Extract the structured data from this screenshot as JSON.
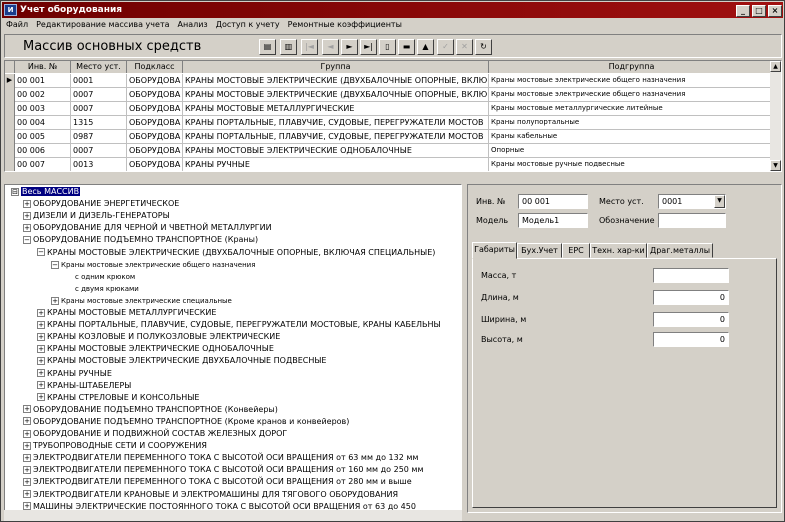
{
  "window": {
    "title": "Учет оборудования",
    "icon_label": "И",
    "controls": [
      "_",
      "□",
      "×"
    ]
  },
  "menu": [
    "Файл",
    "Редактирование массива учета",
    "Анализ",
    "Доступ к учету",
    "Ремонтные коэффициенты"
  ],
  "header": {
    "title": "Массив основных средств"
  },
  "nav_buttons": [
    {
      "icon": "export-icon",
      "glyph": "▤",
      "enabled": true
    },
    {
      "icon": "import-icon",
      "glyph": "▥",
      "enabled": true
    },
    {
      "icon": "first-icon",
      "glyph": "|◄",
      "enabled": false
    },
    {
      "icon": "prev-icon",
      "glyph": "◄",
      "enabled": false
    },
    {
      "icon": "next-icon",
      "glyph": "►",
      "enabled": true
    },
    {
      "icon": "last-icon",
      "glyph": "►|",
      "enabled": true
    },
    {
      "icon": "new-icon",
      "glyph": "▯",
      "enabled": true
    },
    {
      "icon": "delete-icon",
      "glyph": "▬",
      "enabled": true
    },
    {
      "icon": "edit-icon",
      "glyph": "▲",
      "enabled": true
    },
    {
      "icon": "post-icon",
      "glyph": "✓",
      "enabled": false
    },
    {
      "icon": "cancel-icon",
      "glyph": "✕",
      "enabled": false
    },
    {
      "icon": "refresh-icon",
      "glyph": "↻",
      "enabled": true
    }
  ],
  "grid": {
    "columns": [
      "Инв. №",
      "Место уст.",
      "Подкласс",
      "Группа",
      "Подгруппа"
    ],
    "rows": [
      [
        "00 001",
        "0001",
        "ОБОРУДОВА",
        "КРАНЫ МОСТОВЫЕ ЭЛЕКТРИЧЕСКИЕ (ДВУХБАЛОЧНЫЕ ОПОРНЫЕ, ВКЛЮ",
        "Краны мостовые электрические общего назначения"
      ],
      [
        "00 002",
        "0007",
        "ОБОРУДОВА",
        "КРАНЫ МОСТОВЫЕ ЭЛЕКТРИЧЕСКИЕ (ДВУХБАЛОЧНЫЕ ОПОРНЫЕ, ВКЛЮ",
        "Краны мостовые электрические общего назначения"
      ],
      [
        "00 003",
        "0007",
        "ОБОРУДОВА",
        "КРАНЫ МОСТОВЫЕ МЕТАЛЛУРГИЧЕСКИЕ",
        "Краны мостовые металлургические литейные"
      ],
      [
        "00 004",
        "1315",
        "ОБОРУДОВА",
        "КРАНЫ ПОРТАЛЬНЫЕ, ПЛАВУЧИЕ, СУДОВЫЕ, ПЕРЕГРУЖАТЕЛИ МОСТОВ",
        "Краны полупортальные"
      ],
      [
        "00 005",
        "0987",
        "ОБОРУДОВА",
        "КРАНЫ ПОРТАЛЬНЫЕ, ПЛАВУЧИЕ, СУДОВЫЕ, ПЕРЕГРУЖАТЕЛИ МОСТОВ",
        "Краны кабельные"
      ],
      [
        "00 006",
        "0007",
        "ОБОРУДОВА",
        "КРАНЫ МОСТОВЫЕ ЭЛЕКТРИЧЕСКИЕ ОДНОБАЛОЧНЫЕ",
        "Опорные"
      ],
      [
        "00 007",
        "0013",
        "ОБОРУДОВА",
        "КРАНЫ РУЧНЫЕ",
        "Краны мостовые ручные подвесные"
      ]
    ]
  },
  "tree": [
    {
      "level": 0,
      "box": "⊟",
      "text": "Весь МАССИВ",
      "selected": true
    },
    {
      "level": 1,
      "box": "+",
      "text": "ОБОРУДОВАНИЕ ЭНЕРГЕТИЧЕСКОЕ"
    },
    {
      "level": 1,
      "box": "+",
      "text": "ДИЗЕЛИ И ДИЗЕЛЬ-ГЕНЕРАТОРЫ"
    },
    {
      "level": 1,
      "box": "+",
      "text": "ОБОРУДОВАНИЕ ДЛЯ ЧЕРНОЙ И ЧВЕТНОЙ МЕТАЛЛУРГИИ"
    },
    {
      "level": 1,
      "box": "−",
      "text": "ОБОРУДОВАНИЕ ПОДЪЕМНО ТРАНСПОРТНОЕ (Краны)"
    },
    {
      "level": 2,
      "box": "−",
      "text": "КРАНЫ МОСТОВЫЕ ЭЛЕКТРИЧЕСКИЕ (ДВУХБАЛОЧНЫЕ ОПОРНЫЕ, ВКЛЮЧАЯ СПЕЦИАЛЬНЫЕ)"
    },
    {
      "level": 3,
      "box": "−",
      "text": "Краны мостовые электрические общего назначения",
      "small": true
    },
    {
      "level": 4,
      "box": "",
      "text": "с одним крюком",
      "small": true
    },
    {
      "level": 4,
      "box": "",
      "text": "с двумя крюками",
      "small": true
    },
    {
      "level": 3,
      "box": "+",
      "text": "Краны мостовые электрические специальные",
      "small": true
    },
    {
      "level": 2,
      "box": "+",
      "text": "КРАНЫ МОСТОВЫЕ МЕТАЛЛУРГИЧЕСКИЕ"
    },
    {
      "level": 2,
      "box": "+",
      "text": "КРАНЫ ПОРТАЛЬНЫЕ, ПЛАВУЧИЕ, СУДОВЫЕ, ПЕРЕГРУЖАТЕЛИ МОСТОВЫЕ, КРАНЫ КАБЕЛЬНЫ"
    },
    {
      "level": 2,
      "box": "+",
      "text": "КРАНЫ КОЗЛОВЫЕ И ПОЛУКОЗЛОВЫЕ ЭЛЕКТРИЧЕСКИЕ"
    },
    {
      "level": 2,
      "box": "+",
      "text": "КРАНЫ МОСТОВЫЕ ЭЛЕКТРИЧЕСКИЕ ОДНОБАЛОЧНЫЕ"
    },
    {
      "level": 2,
      "box": "+",
      "text": "КРАНЫ МОСТОВЫЕ ЭЛЕКТРИЧЕСКИЕ ДВУХБАЛОЧНЫЕ ПОДВЕСНЫЕ"
    },
    {
      "level": 2,
      "box": "+",
      "text": "КРАНЫ РУЧНЫЕ"
    },
    {
      "level": 2,
      "box": "+",
      "text": "КРАНЫ-ШТАБЕЛЕРЫ"
    },
    {
      "level": 2,
      "box": "+",
      "text": "КРАНЫ СТРЕЛОВЫЕ И КОНСОЛЬНЫЕ"
    },
    {
      "level": 1,
      "box": "+",
      "text": "ОБОРУДОВАНИЕ ПОДЪЕМНО ТРАНСПОРТНОЕ (Конвейеры)"
    },
    {
      "level": 1,
      "box": "+",
      "text": "ОБОРУДОВАНИЕ ПОДЪЕМНО ТРАНСПОРТНОЕ (Кроме кранов и конвейеров)"
    },
    {
      "level": 1,
      "box": "+",
      "text": "ОБОРУДОВАНИЕ И ПОДВИЖНОЙ СОСТАВ ЖЕЛЕЗНЫХ ДОРОГ"
    },
    {
      "level": 1,
      "box": "+",
      "text": "ТРУБОПРОВОДНЫЕ СЕТИ И СООРУЖЕНИЯ"
    },
    {
      "level": 1,
      "box": "+",
      "text": "ЭЛЕКТРОДВИГАТЕЛИ ПЕРЕМЕННОГО ТОКА С ВЫСОТОЙ ОСИ ВРАЩЕНИЯ от 63 мм до 132 мм"
    },
    {
      "level": 1,
      "box": "+",
      "text": "ЭЛЕКТРОДВИГАТЕЛИ ПЕРЕМЕННОГО ТОКА С ВЫСОТОЙ ОСИ ВРАЩЕНИЯ от 160 мм до 250 мм"
    },
    {
      "level": 1,
      "box": "+",
      "text": "ЭЛЕКТРОДВИГАТЕЛИ ПЕРЕМЕННОГО ТОКА С ВЫСОТОЙ ОСИ ВРАЩЕНИЯ от 280 мм и выше"
    },
    {
      "level": 1,
      "box": "+",
      "text": "ЭЛЕКТРОДВИГАТЕЛИ КРАНОВЫЕ И ЭЛЕКТРОМАШИНЫ ДЛЯ ТЯГОВОГО ОБОРУДОВАНИЯ"
    },
    {
      "level": 1,
      "box": "+",
      "text": "МАШИНЫ ЭЛЕКТРИЧЕСКИЕ ПОСТОЯННОГО ТОКА С ВЫСОТОЙ ОСИ ВРАЩЕНИЯ от 63 до 450"
    }
  ],
  "detail": {
    "inv_label": "Инв. №",
    "inv_value": "00 001",
    "place_label": "Место уст.",
    "place_value": "0001",
    "model_label": "Модель",
    "model_value": "Модель1",
    "designation_label": "Обозначение",
    "designation_value": "",
    "tabs": [
      "Габариты",
      "Бух.Учет",
      "ЕРС",
      "Техн. хар-ки",
      "Драг.металлы"
    ],
    "fields": [
      {
        "label": "Масса, т",
        "value": ""
      },
      {
        "label": "Длина, м",
        "value": "0"
      },
      {
        "label": "Ширина, м",
        "value": "0"
      },
      {
        "label": "Высота, м",
        "value": "0"
      }
    ]
  }
}
